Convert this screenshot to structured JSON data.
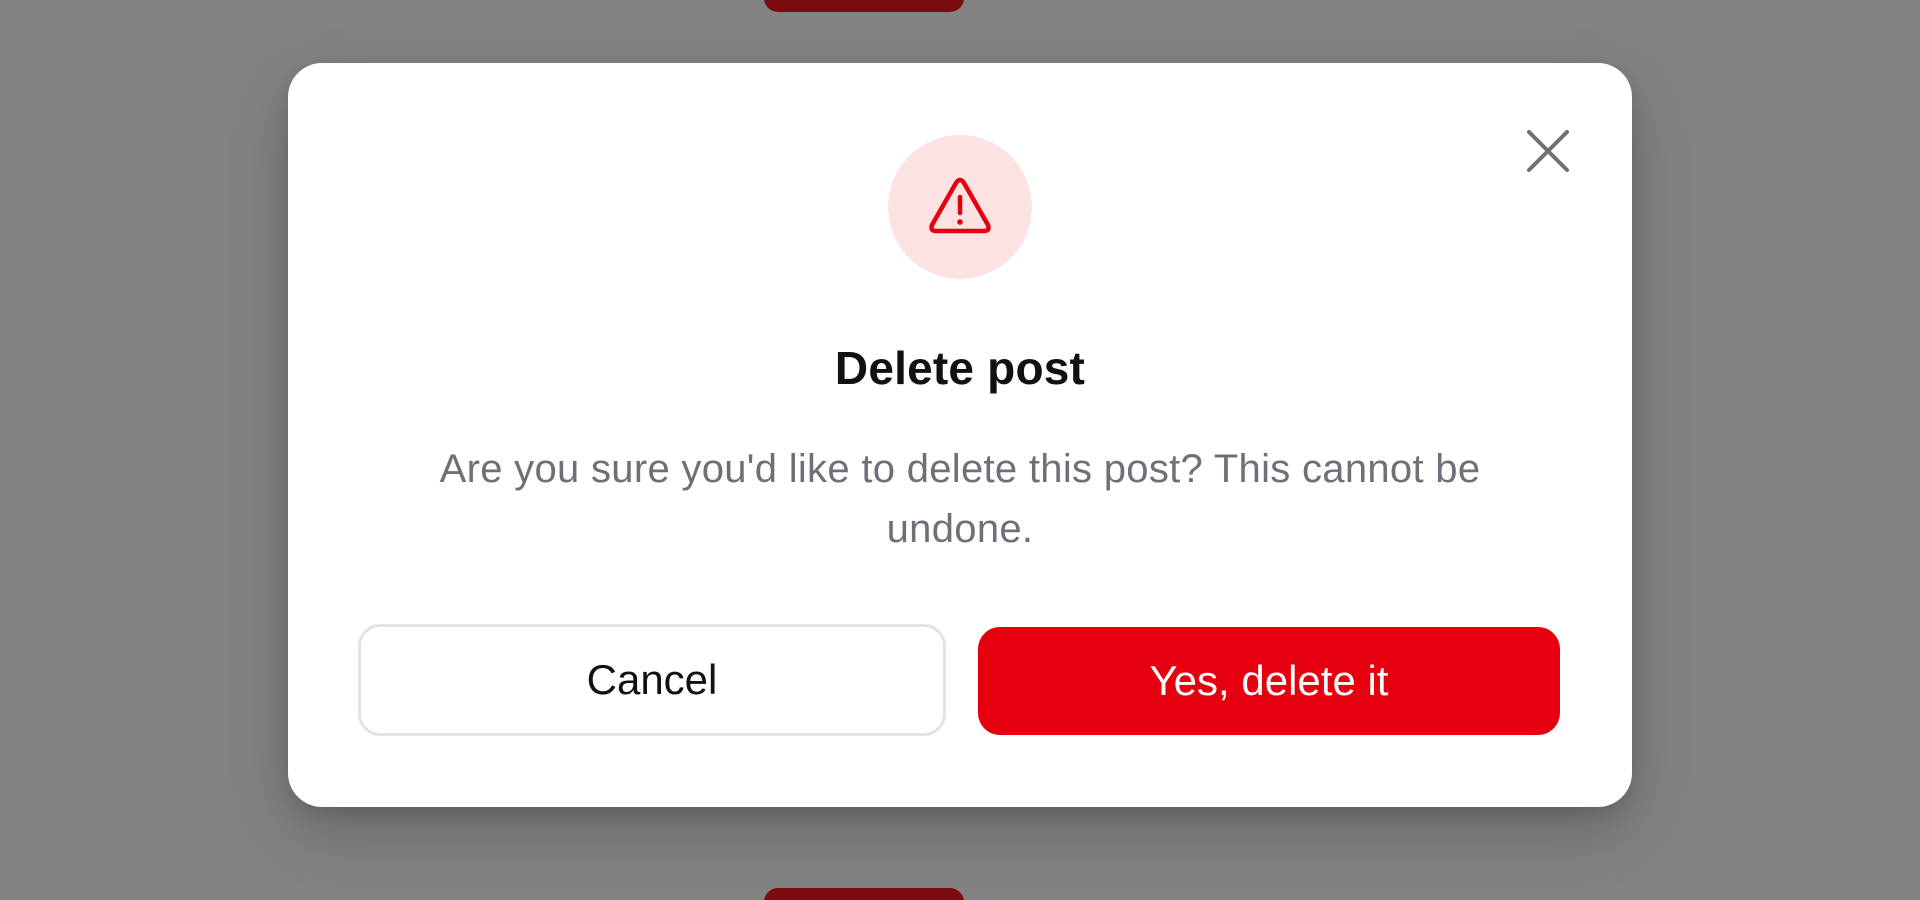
{
  "dialog": {
    "title": "Delete post",
    "message": "Are you sure you'd like to delete this post? This cannot be undone.",
    "icon": "warning-triangle-icon",
    "close_icon": "close-icon",
    "cancel_label": "Cancel",
    "confirm_label": "Yes, delete it"
  },
  "colors": {
    "overlay": "#838383",
    "danger": "#e6000f",
    "danger_soft": "#fde2e2",
    "backdrop_button": "#7b0b0e",
    "title": "#111111",
    "message": "#6f6f78",
    "cancel_border": "#e3e3e6"
  }
}
